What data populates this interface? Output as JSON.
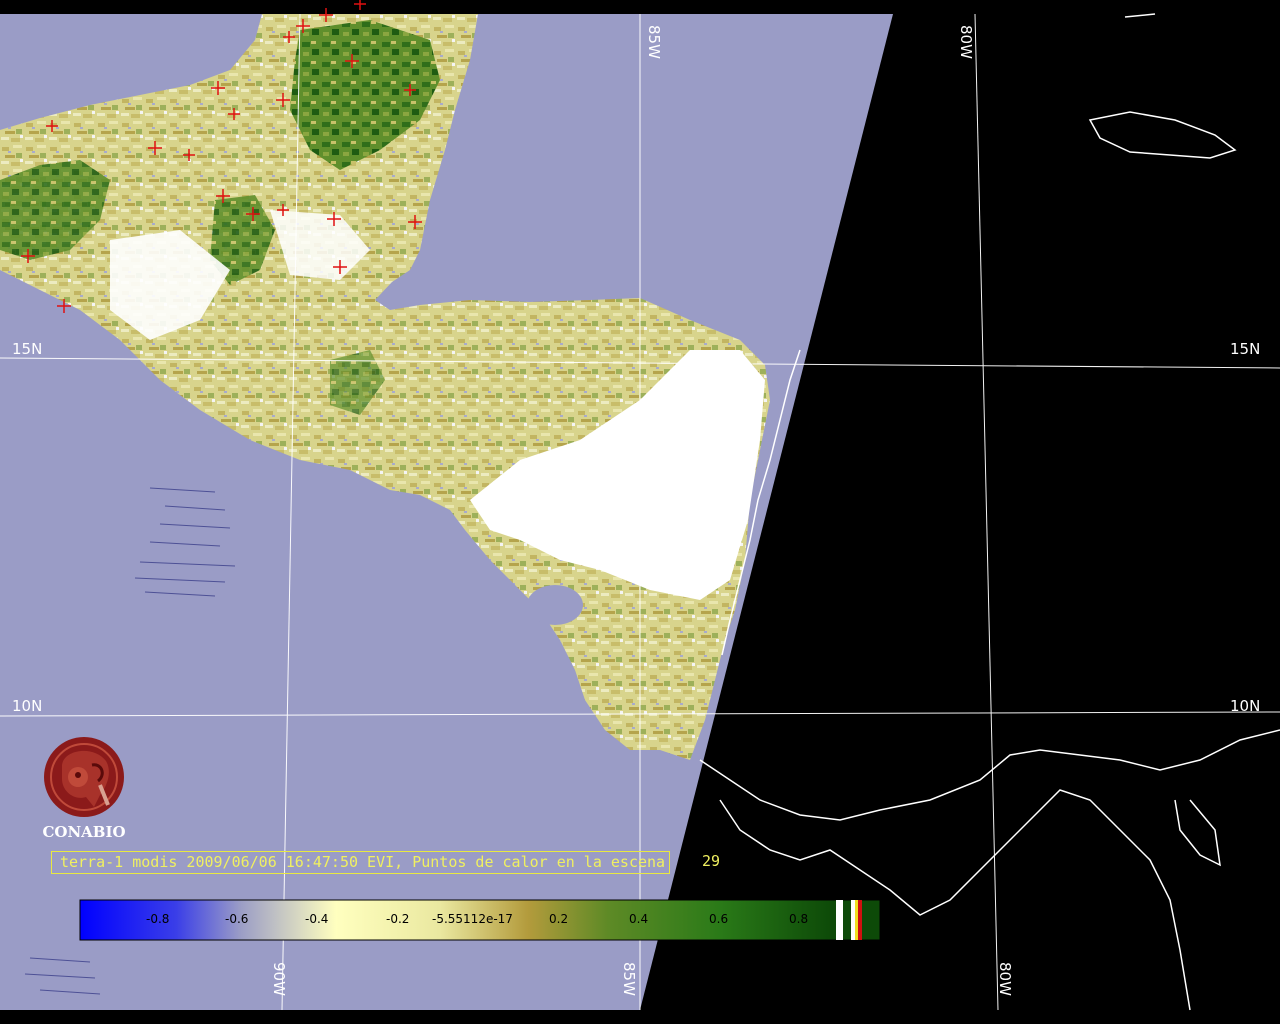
{
  "map": {
    "grid_labels": {
      "lat_15_left": "15N",
      "lat_15_right": "15N",
      "lat_10_left": "10N",
      "lat_10_right": "10N",
      "lon_85_top": "85W",
      "lon_80_top": "80W",
      "lon_90_bottom": "90W",
      "lon_85_bottom": "85W",
      "lon_80_bottom": "80W"
    },
    "colors": {
      "ocean": "#9a9cc6",
      "night": "#000000",
      "grid": "#ffffff",
      "coast": "#ffffff",
      "fire_marker": "#e01010",
      "cloud": "#ffffff"
    }
  },
  "logo": {
    "text": "CONABIO",
    "icon": "conabio-macaw-seal-icon",
    "color": "#8b1a1a"
  },
  "caption": {
    "text": "terra-1 modis 2009/06/06 16:47:50 EVI, Puntos de calor en la escena",
    "hotspot_count": "29"
  },
  "colorbar": {
    "ticks": [
      "-0.8",
      "-0.6",
      "-0.4",
      "-0.2",
      "-5.55112e-17",
      "0.2",
      "0.4",
      "0.6",
      "0.8"
    ],
    "gradient": [
      "#0000ff",
      "#9a9cc6",
      "#ffffbf",
      "#eae8a0",
      "#b39b3c",
      "#3f8a22",
      "#1d6e12",
      "#0a4a08"
    ]
  }
}
